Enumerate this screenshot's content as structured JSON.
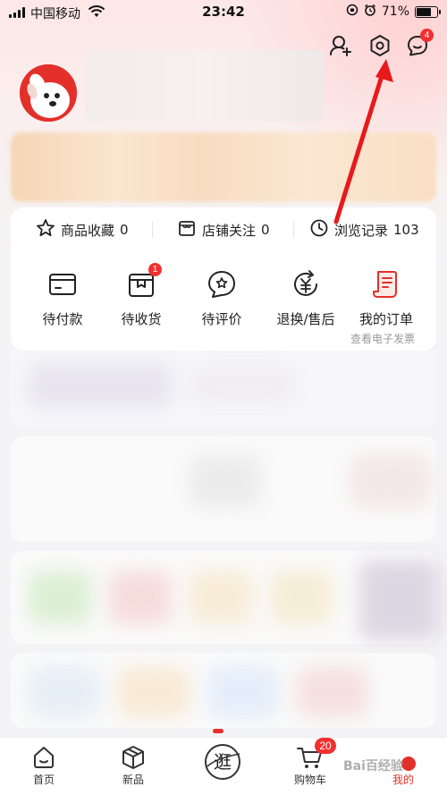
{
  "status_bar": {
    "carrier": "中国移动",
    "time": "23:42",
    "battery": "71%"
  },
  "header": {
    "add_friend_icon": "add-friend-icon",
    "settings_icon": "gear-icon",
    "message_icon": "message-icon",
    "message_badge": "4"
  },
  "favorites": [
    {
      "label": "商品收藏",
      "count": "0",
      "icon": "star-icon"
    },
    {
      "label": "店铺关注",
      "count": "0",
      "icon": "store-icon"
    },
    {
      "label": "浏览记录",
      "count": "103",
      "icon": "clock-icon"
    }
  ],
  "orders": [
    {
      "label": "待付款",
      "icon": "wallet-icon"
    },
    {
      "label": "待收货",
      "icon": "package-icon",
      "badge": "1"
    },
    {
      "label": "待评价",
      "icon": "review-icon"
    },
    {
      "label": "退换/售后",
      "icon": "refund-icon"
    },
    {
      "label": "我的订单",
      "icon": "order-list-icon"
    }
  ],
  "invoice_link": "查看电子发票",
  "tabbar": [
    {
      "label": "首页",
      "icon": "home-icon"
    },
    {
      "label": "新品",
      "icon": "box-icon"
    },
    {
      "label": "逛",
      "icon": "browse-icon"
    },
    {
      "label": "购物车",
      "icon": "cart-icon",
      "badge": "20"
    },
    {
      "label": "我的",
      "icon": "profile-icon"
    }
  ],
  "watermark": "Bai百经验",
  "colors": {
    "brand_red": "#e4302b",
    "badge_red": "#f23030",
    "annotation_red": "#e8191b"
  }
}
